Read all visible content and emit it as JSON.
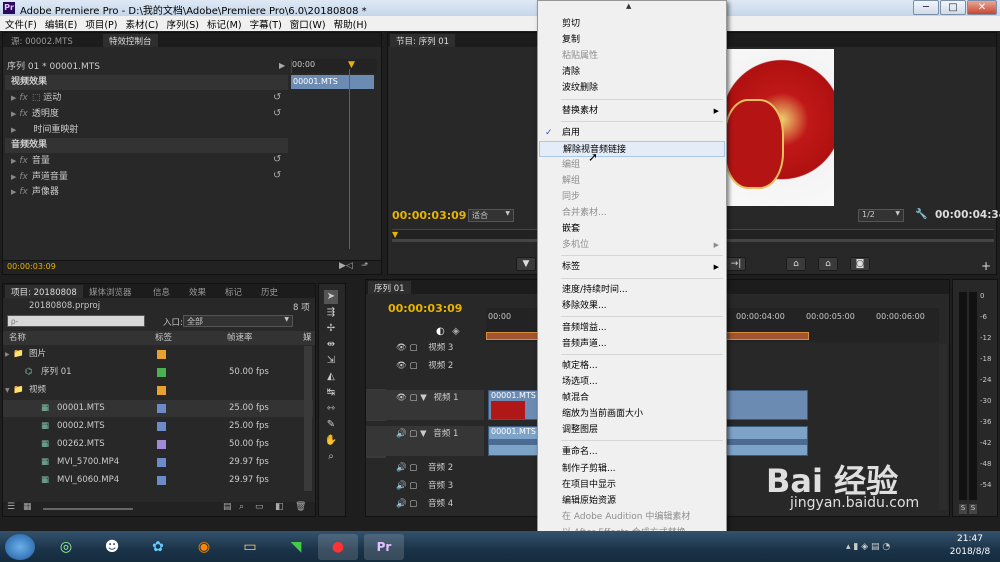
{
  "window": {
    "title": "Adobe Premiere Pro - D:\\我的文档\\Adobe\\Premiere Pro\\6.0\\20180808 *",
    "app_icon": "Pr"
  },
  "menubar": [
    "文件(F)",
    "编辑(E)",
    "项目(P)",
    "素材(C)",
    "序列(S)",
    "标记(M)",
    "字幕(T)",
    "窗口(W)",
    "帮助(H)"
  ],
  "source_panel": {
    "tabs": [
      "源: 00002.MTS",
      "特效控制台"
    ],
    "sequence_label": "序列 01 * 00001.MTS",
    "ruler_time": "00:00",
    "clip_name": "00001.MTS",
    "video_effects_header": "视频效果",
    "video_effects": [
      "运动",
      "透明度",
      "时间重映射"
    ],
    "audio_effects_header": "音频效果",
    "audio_effects": [
      "音量",
      "声道音量",
      "声像器"
    ],
    "fx_glyph": "fx",
    "current_time": "00:00:03:09"
  },
  "program_monitor": {
    "tab": "节目: 序列 01",
    "current_time": "00:00:03:09",
    "fit_label": "适合",
    "zoom_label": "1/2",
    "duration": "00:00:04:34"
  },
  "project_panel": {
    "tabs": [
      "项目: 20180808",
      "媒体浏览器",
      "信息",
      "效果",
      "标记",
      "历史"
    ],
    "project_file": "20180808.prproj",
    "item_count": "8 项",
    "search_placeholder": "ρ-",
    "entry_label": "入口:",
    "entry_value": "全部",
    "columns": [
      "名称",
      "标签",
      "帧速率",
      "媒"
    ],
    "items": [
      {
        "name": "图片",
        "type": "folder",
        "label_color": "#e8a030",
        "fps": ""
      },
      {
        "name": "序列 01",
        "type": "sequence",
        "label_color": "#4caf50",
        "fps": "50.00 fps"
      },
      {
        "name": "视频",
        "type": "folder",
        "label_color": "#e8a030",
        "fps": ""
      },
      {
        "name": "00001.MTS",
        "type": "clip",
        "label_color": "#6c8bc8",
        "fps": "25.00 fps"
      },
      {
        "name": "00002.MTS",
        "type": "clip",
        "label_color": "#6c8bc8",
        "fps": "25.00 fps"
      },
      {
        "name": "00262.MTS",
        "type": "clip",
        "label_color": "#a08ad8",
        "fps": "50.00 fps"
      },
      {
        "name": "MVI_5700.MP4",
        "type": "clip",
        "label_color": "#6c8bc8",
        "fps": "29.97 fps"
      },
      {
        "name": "MVI_6060.MP4",
        "type": "clip",
        "label_color": "#6c8bc8",
        "fps": "29.97 fps"
      }
    ]
  },
  "timeline": {
    "tab": "序列 01",
    "current_time": "00:00:03:09",
    "ruler_labels": [
      "00:00",
      "00:00:04:00",
      "00:00:05:00",
      "00:00:06:00"
    ],
    "v_label": "V",
    "a1_label": "A1",
    "tracks": [
      "视频 3",
      "视频 2",
      "视频 1",
      "音频 1",
      "音频 2",
      "音频 3",
      "音频 4"
    ],
    "video_clip": "00001.MTS [V]",
    "audio_clip": "00001.MTS [A]"
  },
  "audio_meter": {
    "ticks": [
      "0",
      "-6",
      "-12",
      "-18",
      "-24",
      "-30",
      "-36",
      "-42",
      "-48",
      "-54"
    ],
    "solo": "S"
  },
  "context_menu": {
    "items": [
      {
        "label": "剪切",
        "enabled": true
      },
      {
        "label": "复制",
        "enabled": true
      },
      {
        "label": "粘贴属性",
        "enabled": false
      },
      {
        "label": "清除",
        "enabled": true
      },
      {
        "label": "波纹删除",
        "enabled": true
      },
      {
        "sep": true
      },
      {
        "label": "替换素材",
        "enabled": true,
        "submenu": true
      },
      {
        "sep": true
      },
      {
        "label": "启用",
        "enabled": true,
        "checked": true
      },
      {
        "label": "解除视音频链接",
        "enabled": true,
        "highlighted": true
      },
      {
        "label": "编组",
        "enabled": false
      },
      {
        "label": "解组",
        "enabled": false
      },
      {
        "label": "同步",
        "enabled": false
      },
      {
        "label": "合并素材...",
        "enabled": false
      },
      {
        "label": "嵌套",
        "enabled": true
      },
      {
        "label": "多机位",
        "enabled": false,
        "submenu": true
      },
      {
        "sep": true
      },
      {
        "label": "标签",
        "enabled": true,
        "submenu": true
      },
      {
        "sep": true
      },
      {
        "label": "速度/持续时间...",
        "enabled": true
      },
      {
        "label": "移除效果...",
        "enabled": true
      },
      {
        "sep": true
      },
      {
        "label": "音频增益...",
        "enabled": true
      },
      {
        "label": "音频声道...",
        "enabled": true
      },
      {
        "sep": true
      },
      {
        "label": "帧定格...",
        "enabled": true
      },
      {
        "label": "场选项...",
        "enabled": true
      },
      {
        "label": "帧混合",
        "enabled": true
      },
      {
        "label": "缩放为当前画面大小",
        "enabled": true
      },
      {
        "label": "调整图层",
        "enabled": true
      },
      {
        "sep": true
      },
      {
        "label": "重命名...",
        "enabled": true
      },
      {
        "label": "制作子剪辑...",
        "enabled": true
      },
      {
        "label": "在项目中显示",
        "enabled": true
      },
      {
        "label": "编辑原始资源",
        "enabled": true
      },
      {
        "label": "在 Adobe Audition 中编辑素材",
        "enabled": false
      },
      {
        "label": "以 After Effects 合成方式替换",
        "enabled": false
      }
    ]
  },
  "watermark": {
    "brand": "Bai 经验",
    "url": "jingyan.baidu.com"
  },
  "taskbar": {
    "time": "21:47",
    "date": "2018/8/8",
    "pinned": [
      "start-orb",
      "ie-icon",
      "qq-icon",
      "media-icon",
      "firefox-icon",
      "explorer-icon",
      "app-icon",
      "record-icon",
      "premiere-icon"
    ]
  }
}
